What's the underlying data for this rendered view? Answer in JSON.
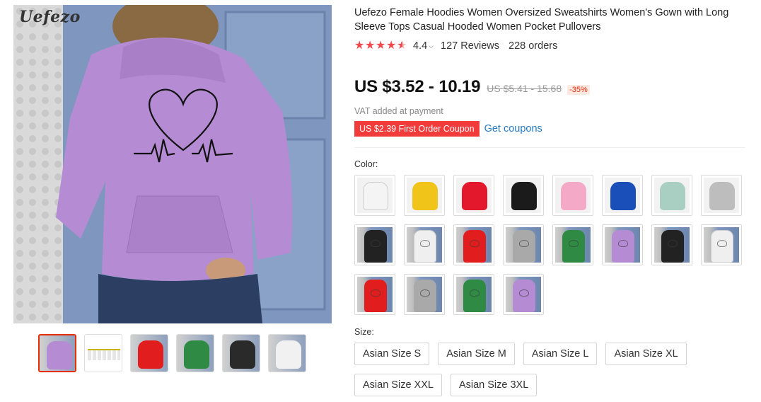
{
  "brand": {
    "logo_text": "Uefezo"
  },
  "product": {
    "title": "Uefezo Female Hoodies Women Oversized Sweatshirts Women's Gown with Long Sleeve Tops Casual Hooded Women Pocket Pullovers",
    "rating": "4.4",
    "rating_stars": 4.4,
    "reviews": "127 Reviews",
    "orders": "228 orders",
    "price": "US $3.52 - 10.19",
    "original_price": "US $5.41 - 15.68",
    "discount": "-35%",
    "vat_note": "VAT added at payment",
    "coupon": "US $2.39 First Order Coupon",
    "get_coupons": "Get coupons"
  },
  "gallery": {
    "main_color": "#b58bd3",
    "thumbnails": [
      {
        "color": "#b58bd3",
        "kind": "photo"
      },
      {
        "color": "#f5f5f5",
        "kind": "size-chart"
      },
      {
        "color": "#e11d1d",
        "kind": "photo"
      },
      {
        "color": "#2f8a43",
        "kind": "photo"
      },
      {
        "color": "#2a2a2a",
        "kind": "photo"
      },
      {
        "color": "#f1f1f1",
        "kind": "photo"
      }
    ]
  },
  "options": {
    "color_label": "Color:",
    "colors": [
      {
        "color": "#f4f4f4",
        "kind": "flat"
      },
      {
        "color": "#f0c419",
        "kind": "flat"
      },
      {
        "color": "#e3182d",
        "kind": "flat"
      },
      {
        "color": "#1b1b1b",
        "kind": "flat"
      },
      {
        "color": "#f4a9c6",
        "kind": "flat"
      },
      {
        "color": "#1a4eb8",
        "kind": "flat"
      },
      {
        "color": "#a8cfc2",
        "kind": "flat"
      },
      {
        "color": "#bdbdbd",
        "kind": "flat"
      },
      {
        "color": "#222222",
        "kind": "photo"
      },
      {
        "color": "#efefef",
        "kind": "photo"
      },
      {
        "color": "#e11d1d",
        "kind": "photo"
      },
      {
        "color": "#a9a9a9",
        "kind": "photo"
      },
      {
        "color": "#2f8a43",
        "kind": "photo"
      },
      {
        "color": "#b58bd3",
        "kind": "photo"
      },
      {
        "color": "#222222",
        "kind": "photo"
      },
      {
        "color": "#efefef",
        "kind": "photo"
      },
      {
        "color": "#e11d1d",
        "kind": "photo"
      },
      {
        "color": "#a9a9a9",
        "kind": "photo"
      },
      {
        "color": "#2f8a43",
        "kind": "photo"
      },
      {
        "color": "#b58bd3",
        "kind": "photo"
      }
    ],
    "size_label": "Size:",
    "sizes": [
      "Asian Size S",
      "Asian Size M",
      "Asian Size L",
      "Asian Size XL",
      "Asian Size XXL",
      "Asian Size 3XL"
    ]
  }
}
